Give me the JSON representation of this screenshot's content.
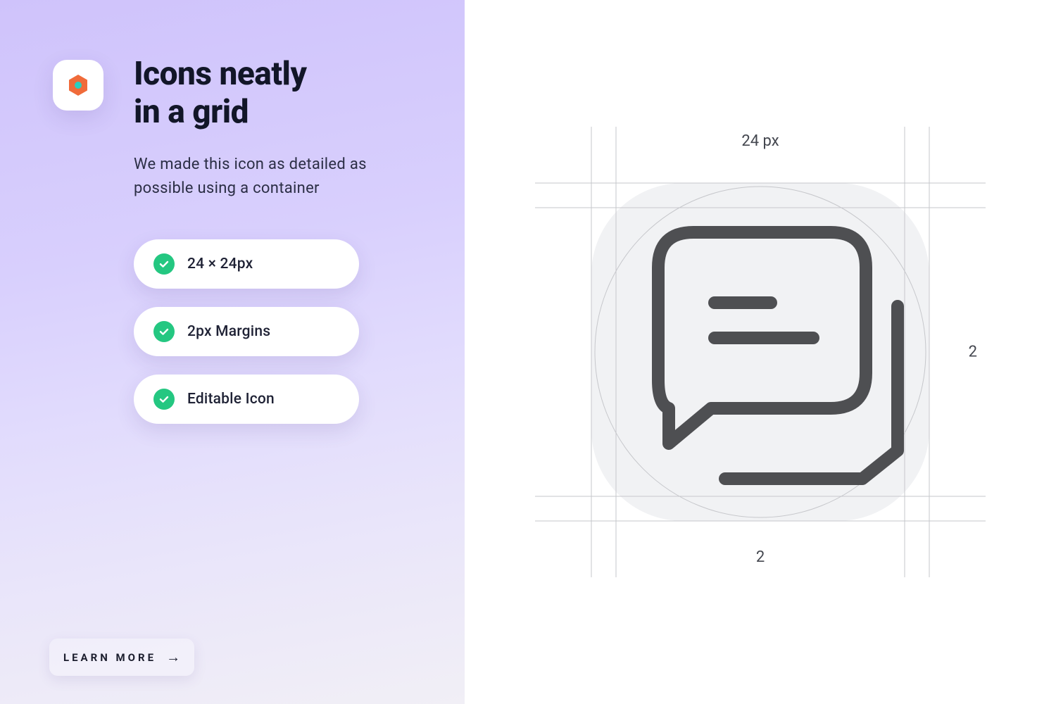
{
  "headline_line1": "Icons neatly",
  "headline_line2": "in a grid",
  "subhead": "We made this icon as detailed as possible using a container",
  "features": [
    {
      "label": "24 × 24px"
    },
    {
      "label": "2px Margins"
    },
    {
      "label": "Editable Icon"
    }
  ],
  "cta": "LEARN MORE",
  "diagram": {
    "top_label": "24 px",
    "right_label": "2",
    "bottom_label": "2"
  },
  "colors": {
    "accent_green": "#24c781",
    "logo_orange": "#f06b3a",
    "logo_teal": "#2bcfc0",
    "icon_stroke": "#4e4f52"
  }
}
